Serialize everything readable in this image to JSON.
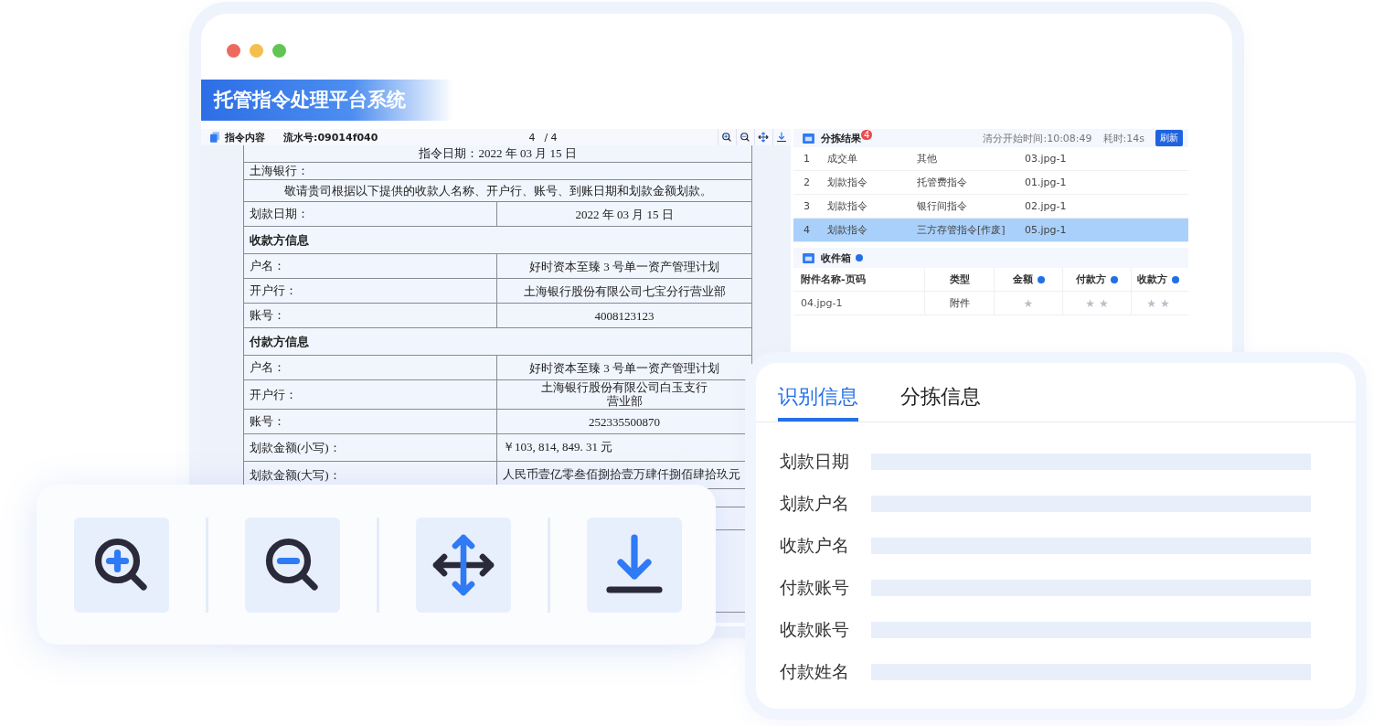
{
  "window": {
    "title": "托管指令处理平台系统"
  },
  "doc_panel": {
    "title": "指令内容",
    "serial": "流水号:09014f040",
    "page": "4",
    "page_total": "/ 4",
    "tools": [
      {
        "kind": "zoom-in"
      },
      {
        "kind": "zoom-out"
      },
      {
        "kind": "move"
      },
      {
        "kind": "download"
      }
    ],
    "date_line": "指令日期：2022 年 03 月 15 日",
    "bank_line": "土海银行：",
    "instruction": "敬请贵司根据以下提供的收款人名称、开户行、账号、到账日期和划款金额划款。",
    "rows": [
      {
        "kind": "pair",
        "label": "划款日期：",
        "value": "2022 年 03 月 15 日"
      },
      {
        "kind": "section",
        "label": "收款方信息"
      },
      {
        "kind": "pair",
        "label": "户名：",
        "value": "好时资本至臻 3 号单一资产管理计划"
      },
      {
        "kind": "pair",
        "label": "开户行：",
        "value": "土海银行股份有限公司七宝分行营业部"
      },
      {
        "kind": "pair",
        "label": "账号：",
        "value": "4008123123"
      },
      {
        "kind": "section",
        "label": "付款方信息"
      },
      {
        "kind": "pair",
        "label": "户名：",
        "value": "好时资本至臻 3 号单一资产管理计划"
      },
      {
        "kind": "pair-narrow",
        "label": "开户行：",
        "value": "土海银行股份有限公司白玉支行营业部"
      },
      {
        "kind": "pair",
        "label": "账号：",
        "value": "252335500870"
      },
      {
        "kind": "amount",
        "label": "划款金额(小写)：",
        "value": "￥103, 814, 849. 31 元"
      },
      {
        "kind": "amount",
        "label": "划款金额(大写)：",
        "value": "人民币壹亿零叁佰捌拾壹万肆仟捌佰肆拾玖元"
      }
    ]
  },
  "sort_results": {
    "title": "分拣结果",
    "badge": "4",
    "start_time": "清分开始时间:10:08:49",
    "elapsed": "耗时:14s",
    "refresh": "刷新",
    "rows": [
      {
        "index": "1",
        "category": "成交单",
        "type": "其他",
        "file": "03.jpg-1",
        "selected": false
      },
      {
        "index": "2",
        "category": "划款指令",
        "type": "托管费指令",
        "file": "01.jpg-1",
        "selected": false
      },
      {
        "index": "3",
        "category": "划款指令",
        "type": "银行间指令",
        "file": "02.jpg-1",
        "selected": false
      },
      {
        "index": "4",
        "category": "划款指令",
        "type": "三方存管指令[作废]",
        "file": "05.jpg-1",
        "selected": true
      }
    ]
  },
  "inbox": {
    "title": "收件箱",
    "columns": [
      {
        "label": "附件名称-页码"
      },
      {
        "label": "类型"
      },
      {
        "label": "金额",
        "info": true
      },
      {
        "label": "付款方",
        "info": true
      },
      {
        "label": "收款方",
        "info": true
      }
    ],
    "rows": [
      {
        "cells": [
          "04.jpg-1",
          "附件",
          "★",
          "★ ★",
          "★ ★"
        ]
      }
    ]
  },
  "zoom_toolbar": [
    {
      "kind": "zoom-in"
    },
    {
      "kind": "zoom-out"
    },
    {
      "kind": "move"
    },
    {
      "kind": "download"
    }
  ],
  "recognition_card": {
    "tabs": [
      {
        "label": "识别信息",
        "selected": true
      },
      {
        "label": "分拣信息",
        "selected": false
      }
    ],
    "fields": [
      {
        "label": "划款日期"
      },
      {
        "label": "划款户名"
      },
      {
        "label": "收款户名"
      },
      {
        "label": "付款账号"
      },
      {
        "label": "收款账号"
      },
      {
        "label": "付款姓名"
      }
    ]
  }
}
